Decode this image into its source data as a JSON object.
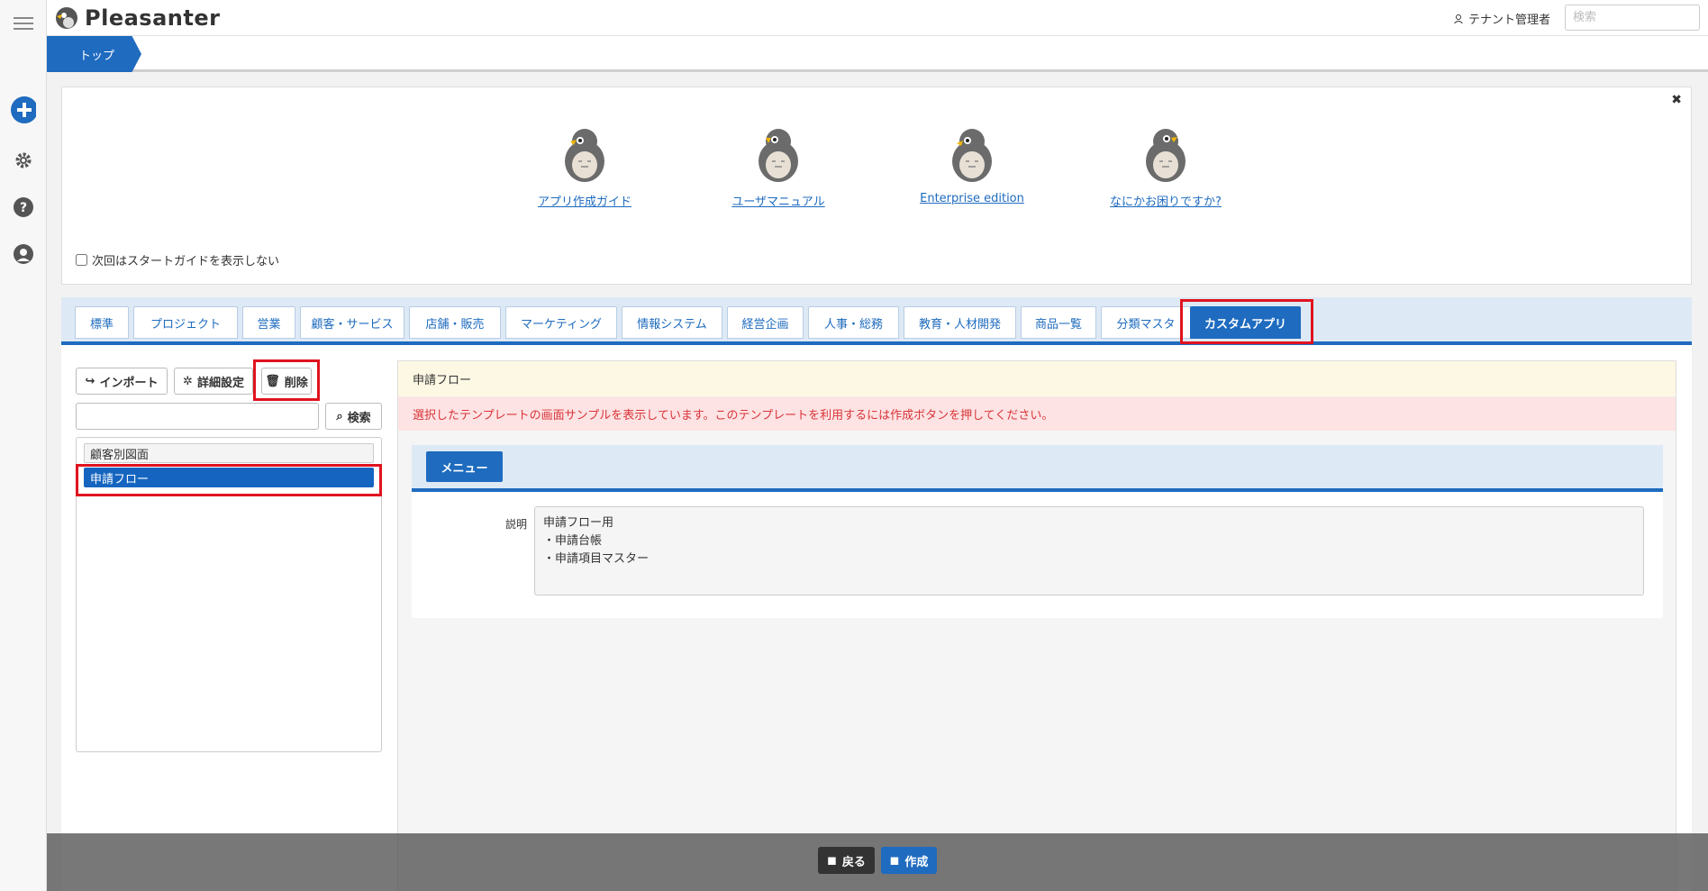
{
  "header": {
    "logo_text": "Pleasanter",
    "user_name": "テナント管理者",
    "search_placeholder": "検索"
  },
  "breadcrumb": {
    "top": "トップ"
  },
  "guide": {
    "items": [
      {
        "label": "アプリ作成ガイド"
      },
      {
        "label": "ユーザマニュアル"
      },
      {
        "label": "Enterprise edition"
      },
      {
        "label": "なにかお困りですか?"
      }
    ],
    "checkbox_label": "次回はスタートガイドを表示しない",
    "close": "✖"
  },
  "tabs": [
    "標準",
    "プロジェクト",
    "営業",
    "顧客・サービス",
    "店舗・販売",
    "マーケティング",
    "情報システム",
    "経営企画",
    "人事・総務",
    "教育・人材開発",
    "商品一覧",
    "分類マスタ",
    "カスタムアプリ"
  ],
  "active_tab": "カスタムアプリ",
  "left": {
    "import_label": "インポート",
    "settings_label": "詳細設定",
    "delete_label": "削除",
    "search_label": "検索",
    "list": [
      "顧客別図面",
      "申請フロー"
    ]
  },
  "right": {
    "title": "申請フロー",
    "message": "選択したテンプレートの画面サンプルを表示しています。このテンプレートを利用するには作成ボタンを押してください。",
    "menu_label": "メニュー",
    "desc_label": "説明",
    "desc_text": "申請フロー用\n・申請台帳\n・申請項目マスター"
  },
  "footer": {
    "back_label": "戻る",
    "create_label": "作成"
  },
  "colors": {
    "accent": "#1e6bbf",
    "highlight": "#e0131f"
  }
}
